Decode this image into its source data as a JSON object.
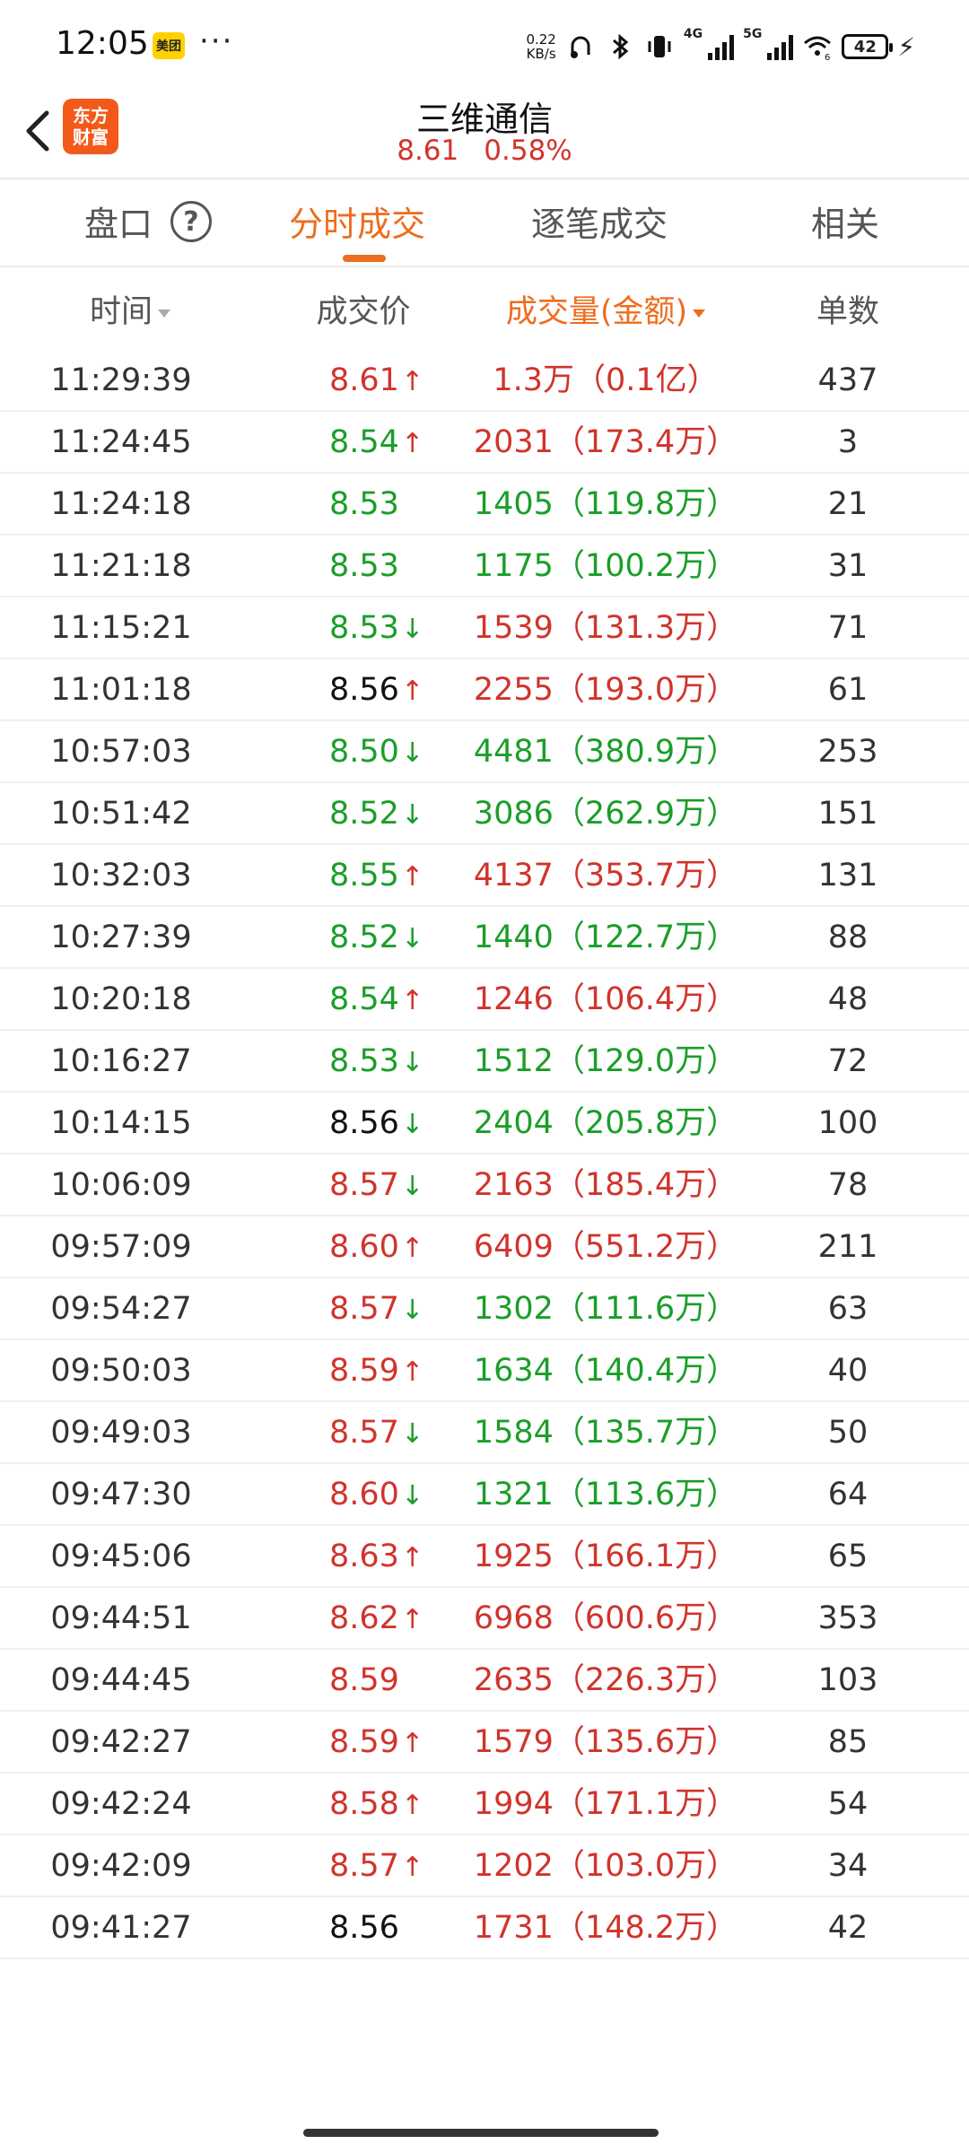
{
  "status": {
    "time": "12:05",
    "app_badge": "美团",
    "dots": "···",
    "speed_value": "0.22",
    "speed_unit": "KB/s",
    "net1": "4G",
    "net2": "5G",
    "wifi_sub": "6",
    "battery": "42",
    "icons": [
      "headphones-icon",
      "bluetooth-icon",
      "vibrate-icon",
      "signal-icon",
      "wifi-icon",
      "battery-icon",
      "charging-icon"
    ]
  },
  "header": {
    "logo_line1": "东方",
    "logo_line2": "财富",
    "stock_name": "三维通信",
    "price": "8.61",
    "change_pct": "0.58%"
  },
  "tabs": [
    {
      "label": "盘口"
    },
    {
      "label": "分时成交"
    },
    {
      "label": "逐笔成交"
    },
    {
      "label": "相关"
    }
  ],
  "columns": {
    "time": "时间",
    "price": "成交价",
    "volume": "成交量(金额)",
    "count": "单数"
  },
  "colors": {
    "accent": "#ee6d1e",
    "up": "#d0342c",
    "down": "#1a9e29",
    "neutral": "#111111"
  },
  "rows": [
    {
      "time": "11:29:39",
      "price": "8.61",
      "pc": "red",
      "arrow": "↑",
      "ac": "red",
      "vol": "1.3万（0.1亿）",
      "vc": "red",
      "count": "437"
    },
    {
      "time": "11:24:45",
      "price": "8.54",
      "pc": "green",
      "arrow": "↑",
      "ac": "red",
      "vol": "2031（173.4万）",
      "vc": "red",
      "count": "3"
    },
    {
      "time": "11:24:18",
      "price": "8.53",
      "pc": "green",
      "arrow": "",
      "ac": "",
      "vol": "1405（119.8万）",
      "vc": "green",
      "count": "21"
    },
    {
      "time": "11:21:18",
      "price": "8.53",
      "pc": "green",
      "arrow": "",
      "ac": "",
      "vol": "1175（100.2万）",
      "vc": "green",
      "count": "31"
    },
    {
      "time": "11:15:21",
      "price": "8.53",
      "pc": "green",
      "arrow": "↓",
      "ac": "green",
      "vol": "1539（131.3万）",
      "vc": "red",
      "count": "71"
    },
    {
      "time": "11:01:18",
      "price": "8.56",
      "pc": "black",
      "arrow": "↑",
      "ac": "red",
      "vol": "2255（193.0万）",
      "vc": "red",
      "count": "61"
    },
    {
      "time": "10:57:03",
      "price": "8.50",
      "pc": "green",
      "arrow": "↓",
      "ac": "green",
      "vol": "4481（380.9万）",
      "vc": "green",
      "count": "253"
    },
    {
      "time": "10:51:42",
      "price": "8.52",
      "pc": "green",
      "arrow": "↓",
      "ac": "green",
      "vol": "3086（262.9万）",
      "vc": "green",
      "count": "151"
    },
    {
      "time": "10:32:03",
      "price": "8.55",
      "pc": "green",
      "arrow": "↑",
      "ac": "red",
      "vol": "4137（353.7万）",
      "vc": "red",
      "count": "131"
    },
    {
      "time": "10:27:39",
      "price": "8.52",
      "pc": "green",
      "arrow": "↓",
      "ac": "green",
      "vol": "1440（122.7万）",
      "vc": "green",
      "count": "88"
    },
    {
      "time": "10:20:18",
      "price": "8.54",
      "pc": "green",
      "arrow": "↑",
      "ac": "red",
      "vol": "1246（106.4万）",
      "vc": "red",
      "count": "48"
    },
    {
      "time": "10:16:27",
      "price": "8.53",
      "pc": "green",
      "arrow": "↓",
      "ac": "green",
      "vol": "1512（129.0万）",
      "vc": "green",
      "count": "72"
    },
    {
      "time": "10:14:15",
      "price": "8.56",
      "pc": "black",
      "arrow": "↓",
      "ac": "green",
      "vol": "2404（205.8万）",
      "vc": "green",
      "count": "100"
    },
    {
      "time": "10:06:09",
      "price": "8.57",
      "pc": "red",
      "arrow": "↓",
      "ac": "green",
      "vol": "2163（185.4万）",
      "vc": "red",
      "count": "78"
    },
    {
      "time": "09:57:09",
      "price": "8.60",
      "pc": "red",
      "arrow": "↑",
      "ac": "red",
      "vol": "6409（551.2万）",
      "vc": "red",
      "count": "211"
    },
    {
      "time": "09:54:27",
      "price": "8.57",
      "pc": "red",
      "arrow": "↓",
      "ac": "green",
      "vol": "1302（111.6万）",
      "vc": "green",
      "count": "63"
    },
    {
      "time": "09:50:03",
      "price": "8.59",
      "pc": "red",
      "arrow": "↑",
      "ac": "red",
      "vol": "1634（140.4万）",
      "vc": "green",
      "count": "40"
    },
    {
      "time": "09:49:03",
      "price": "8.57",
      "pc": "red",
      "arrow": "↓",
      "ac": "green",
      "vol": "1584（135.7万）",
      "vc": "green",
      "count": "50"
    },
    {
      "time": "09:47:30",
      "price": "8.60",
      "pc": "red",
      "arrow": "↓",
      "ac": "green",
      "vol": "1321（113.6万）",
      "vc": "green",
      "count": "64"
    },
    {
      "time": "09:45:06",
      "price": "8.63",
      "pc": "red",
      "arrow": "↑",
      "ac": "red",
      "vol": "1925（166.1万）",
      "vc": "red",
      "count": "65"
    },
    {
      "time": "09:44:51",
      "price": "8.62",
      "pc": "red",
      "arrow": "↑",
      "ac": "red",
      "vol": "6968（600.6万）",
      "vc": "red",
      "count": "353"
    },
    {
      "time": "09:44:45",
      "price": "8.59",
      "pc": "red",
      "arrow": "",
      "ac": "",
      "vol": "2635（226.3万）",
      "vc": "red",
      "count": "103"
    },
    {
      "time": "09:42:27",
      "price": "8.59",
      "pc": "red",
      "arrow": "↑",
      "ac": "red",
      "vol": "1579（135.6万）",
      "vc": "red",
      "count": "85"
    },
    {
      "time": "09:42:24",
      "price": "8.58",
      "pc": "red",
      "arrow": "↑",
      "ac": "red",
      "vol": "1994（171.1万）",
      "vc": "red",
      "count": "54"
    },
    {
      "time": "09:42:09",
      "price": "8.57",
      "pc": "red",
      "arrow": "↑",
      "ac": "red",
      "vol": "1202（103.0万）",
      "vc": "red",
      "count": "34"
    },
    {
      "time": "09:41:27",
      "price": "8.56",
      "pc": "black",
      "arrow": "",
      "ac": "",
      "vol": "1731（148.2万）",
      "vc": "red",
      "count": "42"
    }
  ]
}
